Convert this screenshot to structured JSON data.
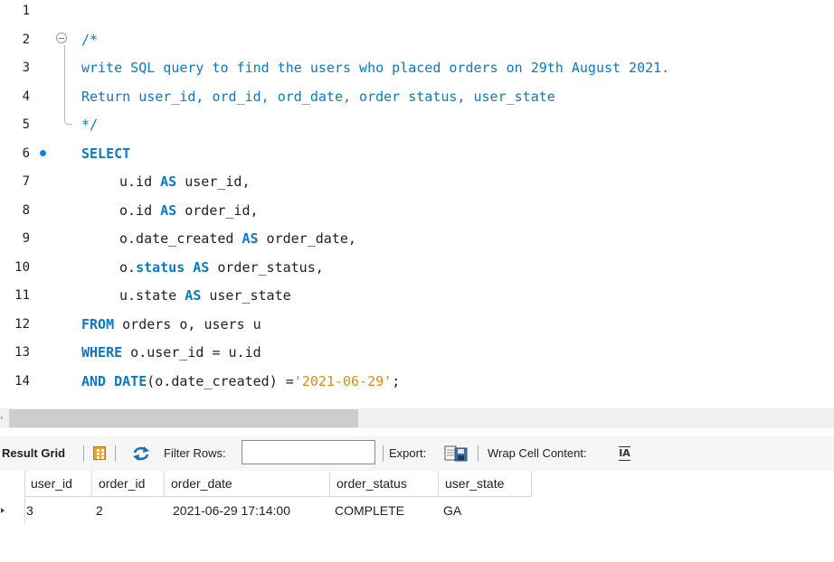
{
  "editor": {
    "lines": [
      {
        "num": "1",
        "tokens": []
      },
      {
        "num": "2",
        "tokens": [
          {
            "t": "/*",
            "c": "comment"
          }
        ]
      },
      {
        "num": "3",
        "tokens": [
          {
            "t": "write SQL query to find the users who placed orders on 29th August 2021.",
            "c": "comment"
          }
        ]
      },
      {
        "num": "4",
        "tokens": [
          {
            "t": "Return user_id, ord_id, ord_date, order status, user_state",
            "c": "comment"
          }
        ]
      },
      {
        "num": "5",
        "tokens": [
          {
            "t": "*/",
            "c": "comment"
          }
        ]
      },
      {
        "num": "6",
        "tokens": [
          {
            "t": "SELECT",
            "c": "kw"
          }
        ]
      },
      {
        "num": "7",
        "indent": true,
        "tokens": [
          {
            "t": "u.id ",
            "c": "plain"
          },
          {
            "t": "AS",
            "c": "kw"
          },
          {
            "t": " user_id,",
            "c": "plain"
          }
        ]
      },
      {
        "num": "8",
        "indent": true,
        "tokens": [
          {
            "t": "o.id ",
            "c": "plain"
          },
          {
            "t": "AS",
            "c": "kw"
          },
          {
            "t": " order_id,",
            "c": "plain"
          }
        ]
      },
      {
        "num": "9",
        "indent": true,
        "tokens": [
          {
            "t": "o.date_created ",
            "c": "plain"
          },
          {
            "t": "AS",
            "c": "kw"
          },
          {
            "t": " order_date,",
            "c": "plain"
          }
        ]
      },
      {
        "num": "10",
        "indent": true,
        "tokens": [
          {
            "t": "o.",
            "c": "plain"
          },
          {
            "t": "status",
            "c": "kw"
          },
          {
            "t": " ",
            "c": "plain"
          },
          {
            "t": "AS",
            "c": "kw"
          },
          {
            "t": " order_status,",
            "c": "plain"
          }
        ]
      },
      {
        "num": "11",
        "indent": true,
        "tokens": [
          {
            "t": "u.state ",
            "c": "plain"
          },
          {
            "t": "AS",
            "c": "kw"
          },
          {
            "t": " user_state",
            "c": "plain"
          }
        ]
      },
      {
        "num": "12",
        "tokens": [
          {
            "t": "FROM",
            "c": "kw"
          },
          {
            "t": " orders o, users u",
            "c": "plain"
          }
        ]
      },
      {
        "num": "13",
        "tokens": [
          {
            "t": "WHERE",
            "c": "kw"
          },
          {
            "t": " o.user_id = u.id",
            "c": "plain"
          }
        ]
      },
      {
        "num": "14",
        "tokens": [
          {
            "t": "AND",
            "c": "kw"
          },
          {
            "t": " ",
            "c": "plain"
          },
          {
            "t": "DATE",
            "c": "kw"
          },
          {
            "t": "(o.date_created) =",
            "c": "plain"
          },
          {
            "t": "'2021-06-29'",
            "c": "str"
          },
          {
            "t": ";",
            "c": "plain"
          }
        ]
      }
    ]
  },
  "toolbar": {
    "result_grid_label": "Result Grid",
    "filter_label": "Filter Rows:",
    "filter_value": "",
    "export_label": "Export:",
    "wrap_label": "Wrap Cell Content:",
    "wrap_icon_glyph": "IA"
  },
  "grid": {
    "columns": [
      "user_id",
      "order_id",
      "order_date",
      "order_status",
      "user_state"
    ],
    "rows": [
      [
        "3",
        "2",
        "2021-06-29 17:14:00",
        "COMPLETE",
        "GA"
      ]
    ]
  },
  "colors": {
    "keyword": "#0b79c4",
    "comment": "#0b79c4",
    "string": "#d98c1c",
    "text": "#1f1f1f",
    "statement_marker": "#1a7fd0"
  },
  "icons": [
    "fold-toggle-icon",
    "statement-marker-icon",
    "grid-view-icon",
    "refresh-icon",
    "export-icon",
    "wrap-cell-icon",
    "row-marker-icon"
  ]
}
